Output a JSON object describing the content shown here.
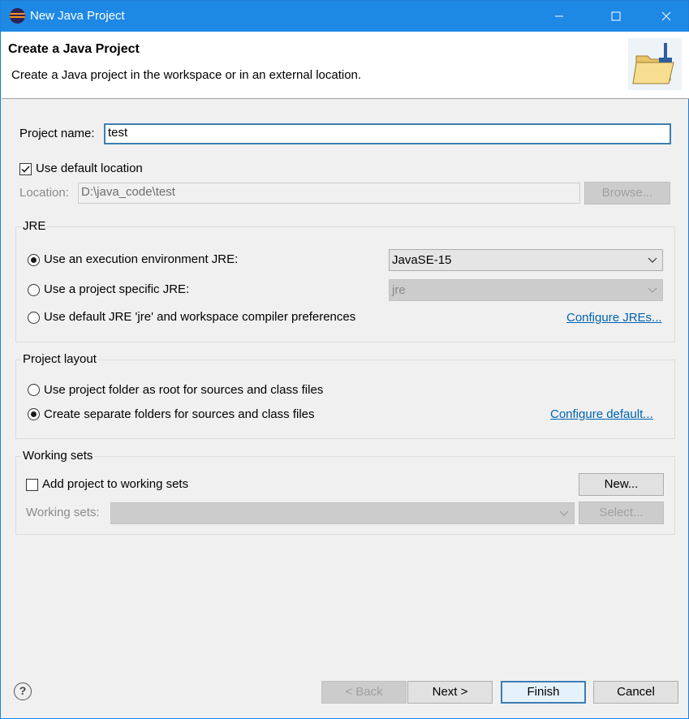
{
  "window": {
    "title": "New Java Project",
    "accent": "#1e88e5"
  },
  "header": {
    "title": "Create a Java Project",
    "description": "Create a Java project in the workspace or in an external location.",
    "icon": "new-java-project-folder-icon"
  },
  "project": {
    "name_label": "Project name:",
    "name_value": "test",
    "use_default_location_label": "Use default location",
    "use_default_location_checked": true,
    "location_label": "Location:",
    "location_value": "D:\\java_code\\test",
    "browse_label": "Browse..."
  },
  "jre": {
    "group_title": "JRE",
    "options": [
      {
        "label": "Use an execution environment JRE:",
        "selected": true
      },
      {
        "label": "Use a project specific JRE:",
        "selected": false
      },
      {
        "label": "Use default JRE 'jre' and workspace compiler preferences",
        "selected": false
      }
    ],
    "env_select_value": "JavaSE-15",
    "project_jre_value": "jre",
    "configure_link": "Configure JREs..."
  },
  "layout": {
    "group_title": "Project layout",
    "options": [
      {
        "label": "Use project folder as root for sources and class files",
        "selected": false
      },
      {
        "label": "Create separate folders for sources and class files",
        "selected": true
      }
    ],
    "configure_link": "Configure default..."
  },
  "working_sets": {
    "group_title": "Working sets",
    "add_label": "Add project to working sets",
    "add_checked": false,
    "new_button": "New...",
    "sets_label": "Working sets:",
    "sets_value": "",
    "select_button": "Select..."
  },
  "footer": {
    "help_icon": "?",
    "back": "< Back",
    "next": "Next >",
    "finish": "Finish",
    "cancel": "Cancel"
  }
}
